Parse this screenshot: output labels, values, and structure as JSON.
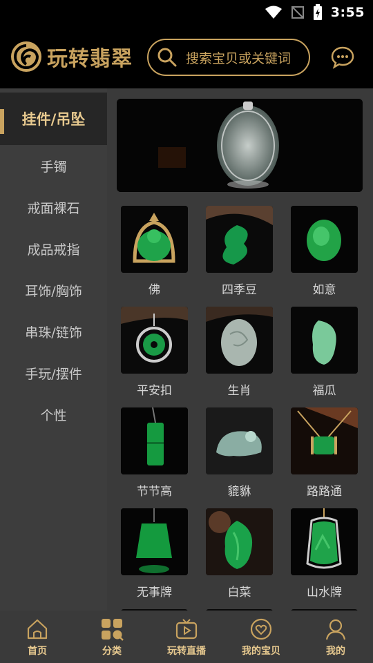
{
  "status_bar": {
    "time": "3:55"
  },
  "header": {
    "logo_text": "玩转翡翠",
    "search_placeholder": "搜索宝贝或关键词"
  },
  "sidebar": {
    "items": [
      {
        "label": "挂件/吊坠",
        "active": true
      },
      {
        "label": "手镯"
      },
      {
        "label": "戒面裸石"
      },
      {
        "label": "成品戒指"
      },
      {
        "label": "耳饰/胸饰"
      },
      {
        "label": "串珠/链饰"
      },
      {
        "label": "手玩/摆件"
      },
      {
        "label": "个性"
      }
    ]
  },
  "categories": [
    {
      "label": "佛"
    },
    {
      "label": "四季豆"
    },
    {
      "label": "如意"
    },
    {
      "label": "平安扣"
    },
    {
      "label": "生肖"
    },
    {
      "label": "福瓜"
    },
    {
      "label": "节节高"
    },
    {
      "label": "貔貅"
    },
    {
      "label": "路路通"
    },
    {
      "label": "无事牌"
    },
    {
      "label": "白菜"
    },
    {
      "label": "山水牌"
    }
  ],
  "bottom_nav": {
    "items": [
      {
        "label": "首页",
        "icon": "home-icon"
      },
      {
        "label": "分类",
        "icon": "category-icon",
        "active": true
      },
      {
        "label": "玩转直播",
        "icon": "live-tv-icon"
      },
      {
        "label": "我的宝贝",
        "icon": "heart-icon"
      },
      {
        "label": "我的",
        "icon": "user-icon"
      }
    ]
  },
  "colors": {
    "accent": "#c9a35f",
    "jade": "#1fa34a"
  }
}
